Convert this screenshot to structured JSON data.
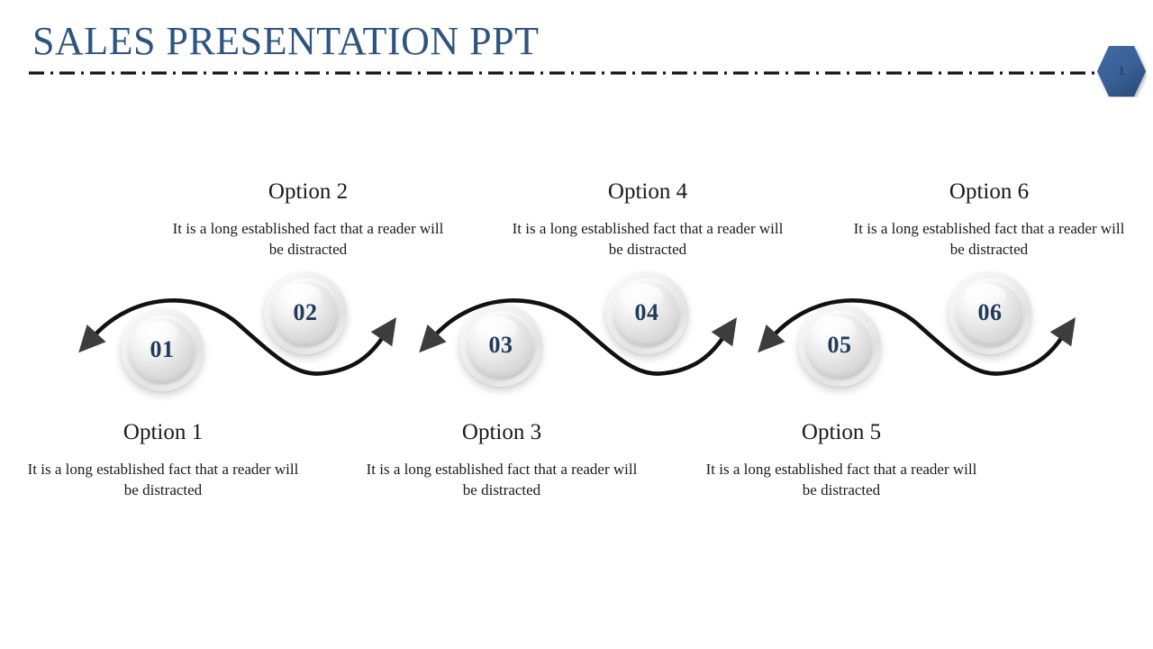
{
  "slide": {
    "title": "SALES PRESENTATION PPT",
    "page_badge": "1",
    "colors": {
      "title": "#2e5481",
      "badge_fill": "#3a6298",
      "number": "#22395c",
      "arrow": "#3d3d3d",
      "rule": "#111111"
    }
  },
  "steps": [
    {
      "number": "01"
    },
    {
      "number": "02"
    },
    {
      "number": "03"
    },
    {
      "number": "04"
    },
    {
      "number": "05"
    },
    {
      "number": "06"
    }
  ],
  "options": [
    {
      "heading": "Option 1",
      "description": "It is a long established fact that a reader will be distracted"
    },
    {
      "heading": "Option 2",
      "description": "It is a long established fact that a reader will be distracted"
    },
    {
      "heading": "Option 3",
      "description": "It is a long established fact that a reader will be distracted"
    },
    {
      "heading": "Option 4",
      "description": "It is a long established fact that a reader will be distracted"
    },
    {
      "heading": "Option 5",
      "description": "It is a long established fact that a reader will be distracted"
    },
    {
      "heading": "Option 6",
      "description": "It is a long established fact that a reader will be distracted"
    }
  ]
}
